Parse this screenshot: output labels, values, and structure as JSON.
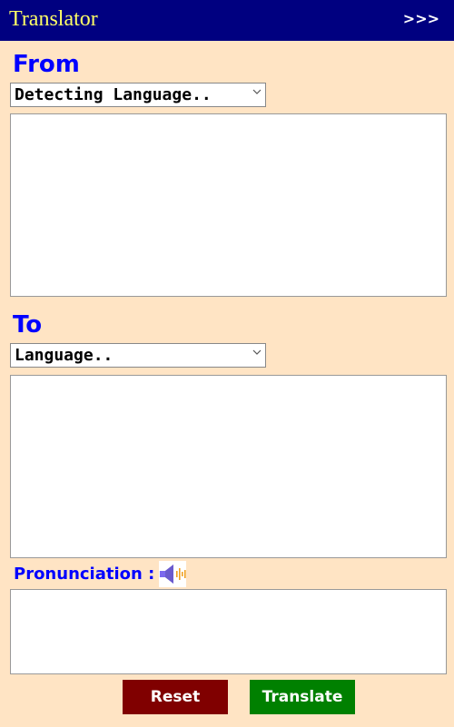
{
  "header": {
    "title": "Translator",
    "expand_label": ">>>",
    "bg_color": "#000080",
    "title_color": "#FFFF66"
  },
  "from": {
    "label": "From",
    "select_value": "Detecting Language..",
    "text": ""
  },
  "to": {
    "label": "To",
    "select_value": "Language..",
    "text": ""
  },
  "pronunciation": {
    "label": "Pronunciation :",
    "icon": "speaker-icon",
    "text": ""
  },
  "actions": {
    "reset_label": "Reset",
    "translate_label": "Translate",
    "reset_color": "#800000",
    "translate_color": "#008000"
  },
  "colors": {
    "page_bg": "#FFE4C4",
    "label": "#0000FF"
  }
}
